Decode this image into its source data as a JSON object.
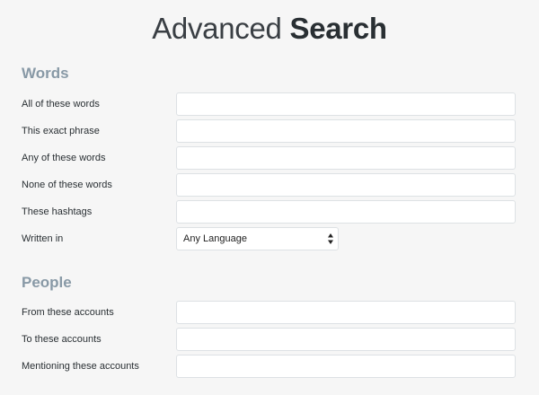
{
  "title": {
    "light": "Advanced",
    "bold": "Search"
  },
  "words": {
    "heading": "Words",
    "all_of_these_words": {
      "label": "All of these words",
      "value": ""
    },
    "this_exact_phrase": {
      "label": "This exact phrase",
      "value": ""
    },
    "any_of_these_words": {
      "label": "Any of these words",
      "value": ""
    },
    "none_of_these_words": {
      "label": "None of these words",
      "value": ""
    },
    "these_hashtags": {
      "label": "These hashtags",
      "value": ""
    },
    "written_in": {
      "label": "Written in",
      "selected": "Any Language"
    }
  },
  "people": {
    "heading": "People",
    "from_these_accounts": {
      "label": "From these accounts",
      "value": ""
    },
    "to_these_accounts": {
      "label": "To these accounts",
      "value": ""
    },
    "mentioning_these_accounts": {
      "label": "Mentioning these accounts",
      "value": ""
    }
  },
  "icons": {
    "select_arrows": "up-down-arrows-icon"
  },
  "colors": {
    "background": "#f6f6f6",
    "section_heading": "#8899a6",
    "input_border": "#dde1e4"
  }
}
